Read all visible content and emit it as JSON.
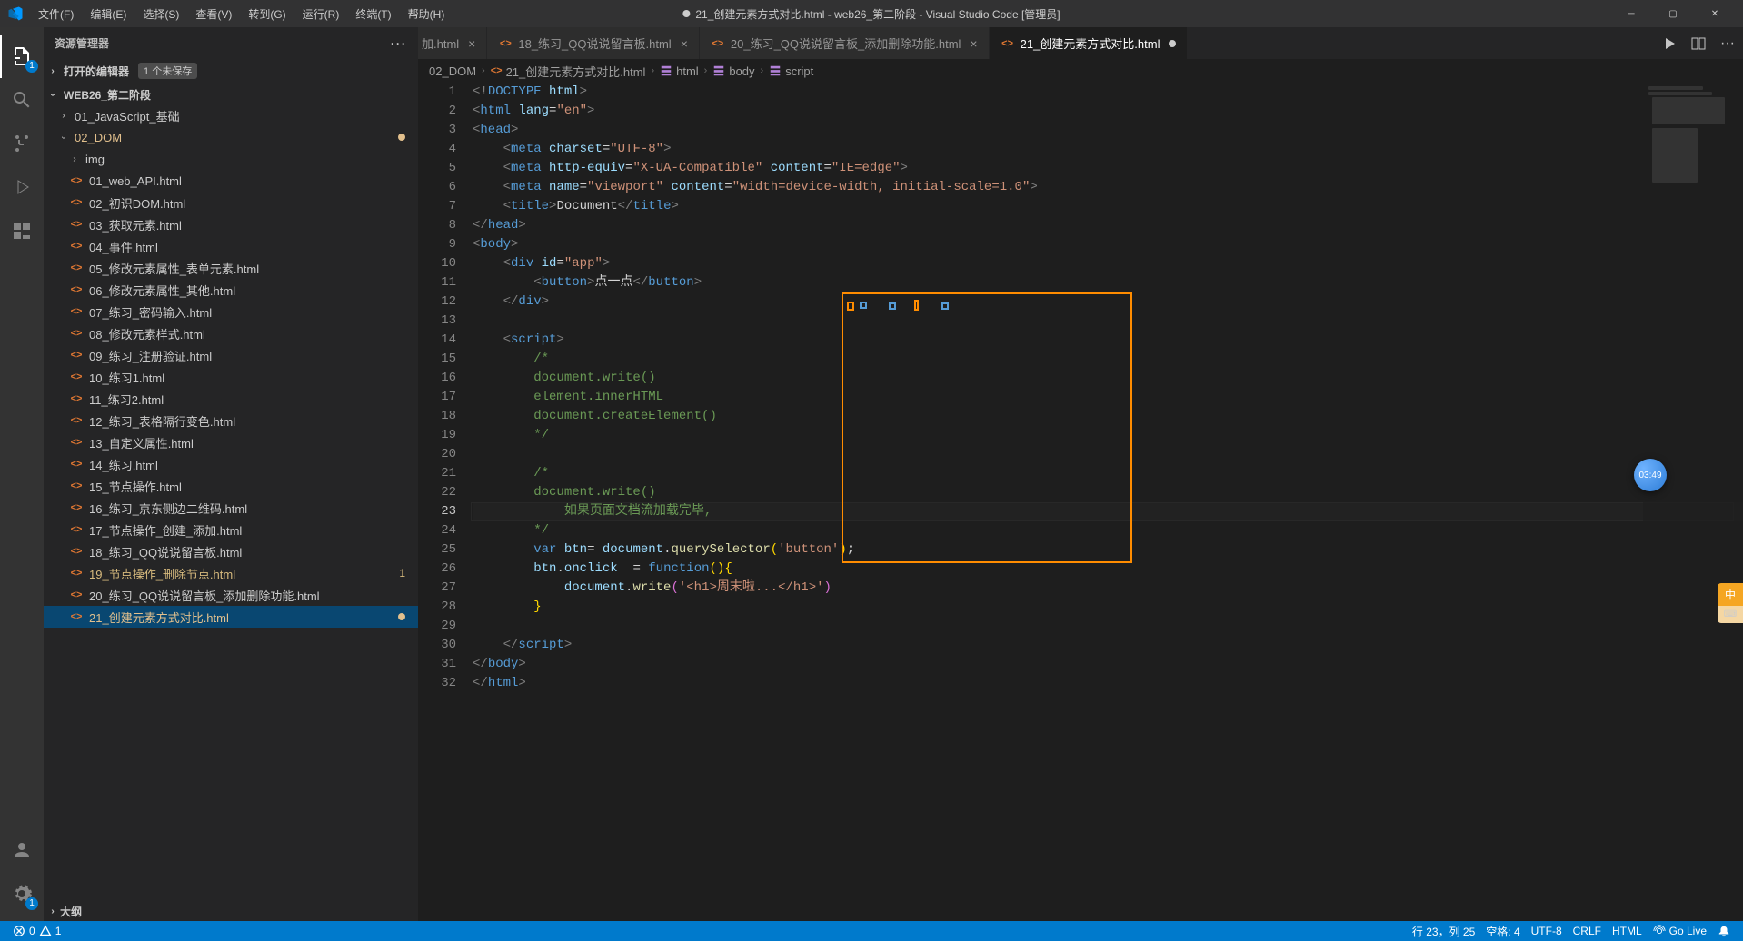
{
  "titlebar": {
    "menus": [
      "文件(F)",
      "编辑(E)",
      "选择(S)",
      "查看(V)",
      "转到(G)",
      "运行(R)",
      "终端(T)",
      "帮助(H)"
    ],
    "title": "21_创建元素方式对比.html - web26_第二阶段 - Visual Studio Code [管理员]"
  },
  "activity": {
    "explorer_badge": "1",
    "settings_badge": "1"
  },
  "sidebar": {
    "panel_title": "资源管理器",
    "open_editors": {
      "label": "打开的编辑器",
      "pill": "1 个未保存"
    },
    "project": "WEB26_第二阶段",
    "folders": {
      "js_basic": "01_JavaScript_基础",
      "dom": "02_DOM",
      "img": "img"
    },
    "files": [
      {
        "name": "01_web_API.html",
        "cls": ""
      },
      {
        "name": "02_初识DOM.html",
        "cls": ""
      },
      {
        "name": "03_获取元素.html",
        "cls": ""
      },
      {
        "name": "04_事件.html",
        "cls": ""
      },
      {
        "name": "05_修改元素属性_表单元素.html",
        "cls": ""
      },
      {
        "name": "06_修改元素属性_其他.html",
        "cls": ""
      },
      {
        "name": "07_练习_密码输入.html",
        "cls": ""
      },
      {
        "name": "08_修改元素样式.html",
        "cls": ""
      },
      {
        "name": "09_练习_注册验证.html",
        "cls": ""
      },
      {
        "name": "10_练习1.html",
        "cls": ""
      },
      {
        "name": "11_练习2.html",
        "cls": ""
      },
      {
        "name": "12_练习_表格隔行变色.html",
        "cls": ""
      },
      {
        "name": "13_自定义属性.html",
        "cls": ""
      },
      {
        "name": "14_练习.html",
        "cls": ""
      },
      {
        "name": "15_节点操作.html",
        "cls": ""
      },
      {
        "name": "16_练习_京东侧边二维码.html",
        "cls": ""
      },
      {
        "name": "17_节点操作_创建_添加.html",
        "cls": ""
      },
      {
        "name": "18_练习_QQ说说留言板.html",
        "cls": ""
      },
      {
        "name": "19_节点操作_删除节点.html",
        "cls": "warn",
        "marker": "1"
      },
      {
        "name": "20_练习_QQ说说留言板_添加删除功能.html",
        "cls": ""
      },
      {
        "name": "21_创建元素方式对比.html",
        "cls": "mod",
        "selected": true,
        "dirty": true
      }
    ],
    "outline": "大纲"
  },
  "tabs": [
    {
      "label": "加.html",
      "partial": true,
      "close": true
    },
    {
      "label": "18_练习_QQ说说留言板.html",
      "close": true
    },
    {
      "label": "20_练习_QQ说说留言板_添加删除功能.html",
      "close": true
    },
    {
      "label": "21_创建元素方式对比.html",
      "active": true,
      "dirty": true
    }
  ],
  "breadcrumb": [
    "02_DOM",
    "21_创建元素方式对比.html",
    "html",
    "body",
    "script"
  ],
  "code": {
    "lines": [
      "<!DOCTYPE html>",
      "<html lang=\"en\">",
      "<head>",
      "    <meta charset=\"UTF-8\">",
      "    <meta http-equiv=\"X-UA-Compatible\" content=\"IE=edge\">",
      "    <meta name=\"viewport\" content=\"width=device-width, initial-scale=1.0\">",
      "    <title>Document</title>",
      "</head>",
      "<body>",
      "    <div id=\"app\">",
      "        <button>点一点</button>",
      "    </div>",
      "",
      "    <script>",
      "        /*",
      "        document.write()",
      "        element.innerHTML",
      "        document.createElement()",
      "        */",
      "",
      "        /*",
      "        document.write()",
      "            如果页面文档流加载完毕,",
      "        */",
      "        var btn= document.querySelector('button');",
      "        btn.onclick  = function(){",
      "            document.write('<h1>周末啦...</h1>')",
      "        }",
      "",
      "    </script>",
      "</body>",
      "</html>"
    ]
  },
  "status": {
    "errors": "0",
    "warnings": "1",
    "ln_col": "行 23，列 25",
    "spaces": "空格: 4",
    "encoding": "UTF-8",
    "eol": "CRLF",
    "lang": "HTML",
    "golive": "Go Live",
    "bell": ""
  },
  "timer": "03:49",
  "side_tag": {
    "top": "中",
    "bottom": "⌨"
  }
}
